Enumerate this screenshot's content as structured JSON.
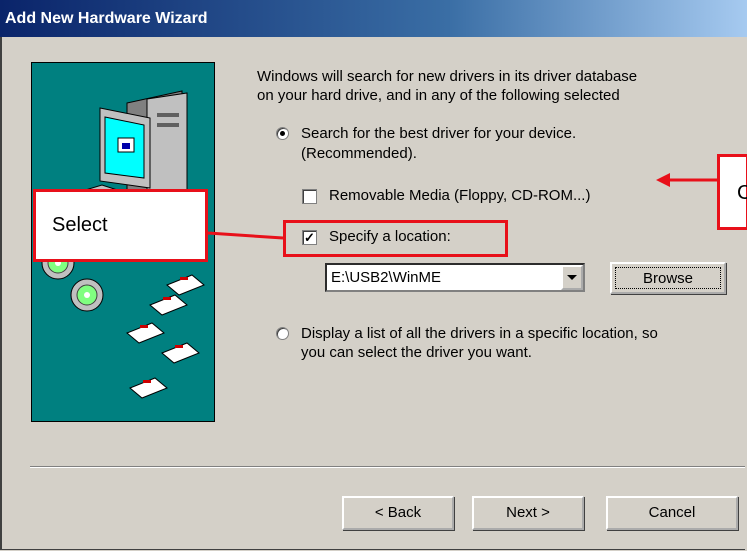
{
  "window": {
    "title": "Add New Hardware Wizard"
  },
  "intro": {
    "line1": "Windows will search for new drivers in its driver database",
    "line2": "on your hard drive, and in any of the following selected"
  },
  "options": {
    "search_best_line1": "Search for the best driver for your device.",
    "search_best_line2": "(Recommended).",
    "removable_media": "Removable Media (Floppy, CD-ROM...)",
    "specify_location": "Specify a location:",
    "location_value": "E:\\USB2\\WinME",
    "browse_label": "Browse",
    "display_list_line1": "Display a list of all the drivers in a specific location, so",
    "display_list_line2": "you can select the driver you want."
  },
  "state": {
    "search_best_selected": true,
    "display_list_selected": false,
    "removable_media_checked": false,
    "specify_location_checked": true
  },
  "buttons": {
    "back": "< Back",
    "next": "Next >",
    "cancel": "Cancel"
  },
  "annotations": {
    "select_label": "Select",
    "right_label": "C"
  },
  "colors": {
    "highlight_red": "#e8101a",
    "art_bg": "#008080",
    "title_bar": "#0a246a"
  }
}
